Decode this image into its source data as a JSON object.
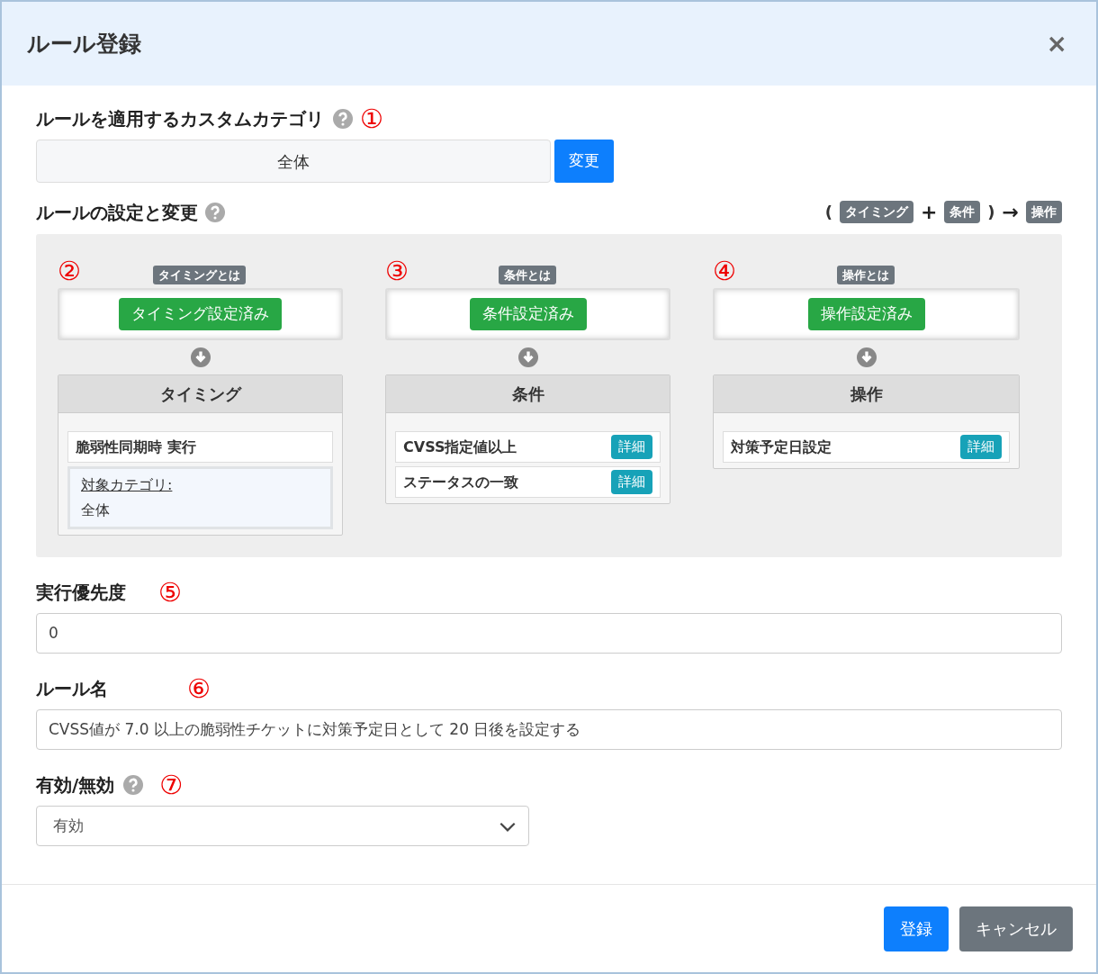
{
  "dialog": {
    "title": "ルール登録",
    "close": "×"
  },
  "category": {
    "label": "ルールを適用するカスタムカテゴリ",
    "callout": "①",
    "value": "全体",
    "button": "変更"
  },
  "settings": {
    "label": "ルールの設定と変更",
    "formula": [
      {
        "kind": "paren",
        "text": "("
      },
      {
        "kind": "tag",
        "text": "タイミング"
      },
      {
        "kind": "op",
        "text": "+"
      },
      {
        "kind": "tag",
        "text": "条件"
      },
      {
        "kind": "paren",
        "text": ")"
      },
      {
        "kind": "op",
        "text": "→"
      },
      {
        "kind": "tag",
        "text": "操作"
      }
    ],
    "columns": [
      {
        "callout": "②",
        "help_badge": "タイミングとは",
        "status_button": "タイミング設定済み",
        "header": "タイミング",
        "items": [
          {
            "kind": "plain",
            "text": "脆弱性同期時 実行"
          },
          {
            "kind": "info",
            "link": "対象カテゴリ:",
            "text": "全体"
          }
        ]
      },
      {
        "callout": "③",
        "help_badge": "条件とは",
        "status_button": "条件設定済み",
        "header": "条件",
        "items": [
          {
            "kind": "detail",
            "text": "CVSS指定値以上",
            "button": "詳細"
          },
          {
            "kind": "detail",
            "text": "ステータスの一致",
            "button": "詳細"
          }
        ]
      },
      {
        "callout": "④",
        "help_badge": "操作とは",
        "status_button": "操作設定済み",
        "header": "操作",
        "items": [
          {
            "kind": "detail",
            "text": "対策予定日設定",
            "button": "詳細"
          }
        ]
      }
    ]
  },
  "priority": {
    "label": "実行優先度",
    "callout": "⑤",
    "value": "0"
  },
  "rule_name": {
    "label": "ルール名",
    "callout": "⑥",
    "value": "CVSS値が 7.0 以上の脆弱性チケットに対策予定日として 20 日後を設定する"
  },
  "enabled": {
    "label": "有効/無効",
    "callout": "⑦",
    "value": "有効"
  },
  "footer": {
    "buttons": [
      {
        "kind": "primary",
        "text": "登録"
      },
      {
        "kind": "secondary",
        "text": "キャンセル"
      }
    ]
  }
}
